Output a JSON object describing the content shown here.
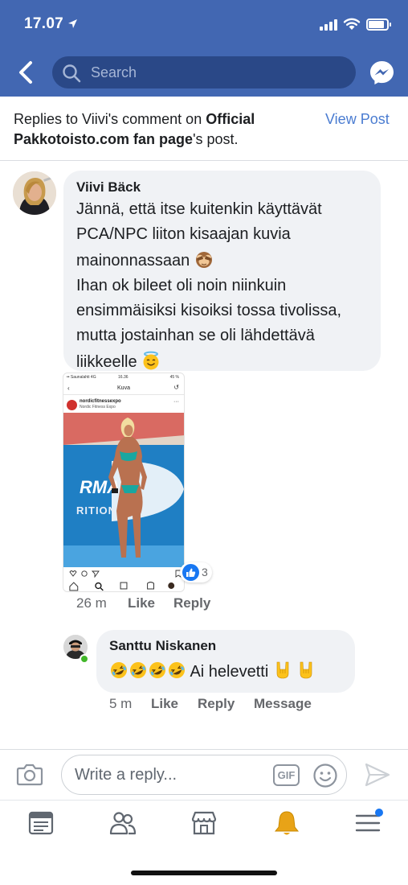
{
  "status_bar": {
    "time": "17.07"
  },
  "top_bar": {
    "search_placeholder": "Search"
  },
  "replies_header": {
    "prefix": "Replies to Viivi's comment on ",
    "page_name_1": "Official",
    "page_name_2": "Pakkotoisto.com fan page",
    "suffix": "'s post",
    "period": ".",
    "view_post": "View Post"
  },
  "comment_1": {
    "author": "Viivi Bäck",
    "line_1": "Jännä, että itse kuitenkin käyttävät",
    "line_2": "PCA/NPC liiton kisaajan kuvia",
    "line_3": "mainonnassaan",
    "line_4": "Ihan ok bileet oli noin niinkuin",
    "line_5": "ensimmäisiksi kisoiksi tossa tivolissa,",
    "line_6": "mutta jostainhan se oli lähdettävä",
    "line_7": "liikkeelle",
    "emoji_1": "see-no-evil-monkey",
    "emoji_2": "smiling-face-with-halo",
    "time": "26 m",
    "like_label": "Like",
    "reply_label": "Reply",
    "reaction_count": "3",
    "attachment": {
      "status_carrier": "•• Saunalahti 4G",
      "status_time": "16.36",
      "status_battery": "45 %",
      "nav_title": "Kuva",
      "username": "nordicfitnessexpo",
      "location": "Nordic Fitness Expo",
      "banner_text_1": "RMA",
      "banner_text_2": "RITION"
    }
  },
  "comment_2": {
    "author": "Santtu Niskanen",
    "text": "Ai helevetti",
    "emoji_rofl": "rolling-on-the-floor-laughing",
    "emoji_horns": "sign-of-the-horns",
    "time": "5 m",
    "like_label": "Like",
    "reply_label": "Reply",
    "message_label": "Message"
  },
  "composer": {
    "placeholder": "Write a reply...",
    "gif_label": "GIF"
  },
  "colors": {
    "brand_blue": "#4267b2",
    "search_bg": "#2a4887",
    "link_blue": "#4a7cd1",
    "bubble_bg": "#f0f2f5",
    "like_blue": "#1877f2",
    "online_green": "#42b72a"
  }
}
